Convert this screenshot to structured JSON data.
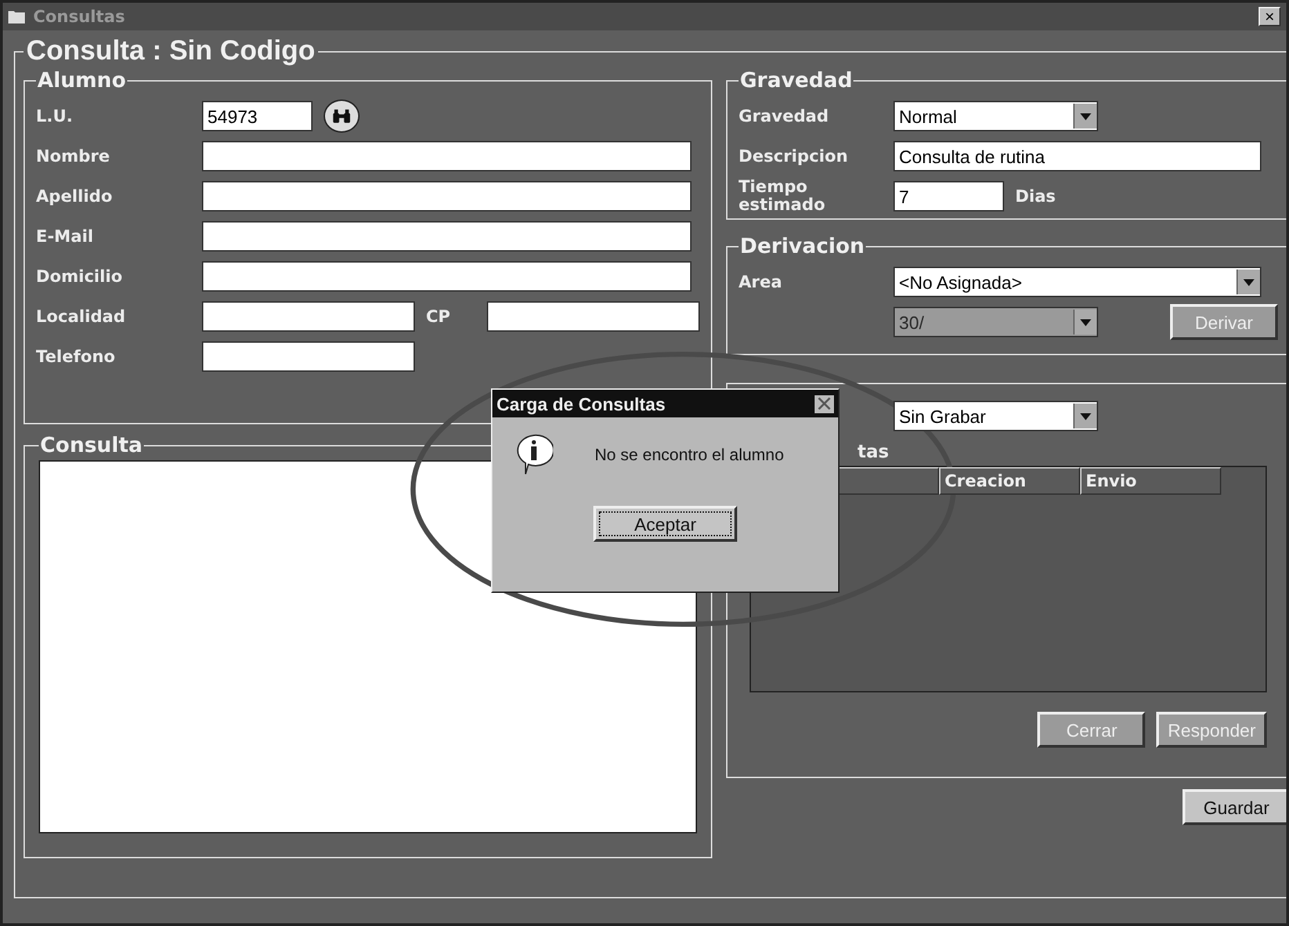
{
  "window": {
    "title": "Consultas",
    "close": "×"
  },
  "form_title": "Consulta : Sin Codigo",
  "alumno": {
    "title": "Alumno",
    "lu": {
      "label": "L.U.",
      "value": "54973"
    },
    "fields": [
      {
        "label": "Nombre"
      },
      {
        "label": "Apellido"
      },
      {
        "label": "E-Mail"
      },
      {
        "label": "Domicilio"
      }
    ],
    "localidad": {
      "label": "Localidad"
    },
    "cp": {
      "label": "CP"
    },
    "telefono": {
      "label": "Telefono"
    }
  },
  "consulta": {
    "title": "Consulta"
  },
  "gravedad": {
    "title": "Gravedad",
    "level_label": "Gravedad",
    "level_value": "Normal",
    "descripcion_label": "Descripcion",
    "descripcion_value": "Consulta de rutina",
    "tiempo_label": "Tiempo estimado",
    "tiempo_value": "7",
    "unit": "Dias"
  },
  "derivacion": {
    "title": "Derivacion",
    "area_label": "Area",
    "area_value": "<No Asignada>",
    "fecha_value": "30/",
    "fecha_disabled": true,
    "button": {
      "label": "Derivar",
      "disabled": true
    }
  },
  "estado": {
    "status_value": "Sin Grabar",
    "respuestas_label": "tas",
    "columns": [
      "Creacion",
      "Envio"
    ],
    "buttons": [
      {
        "label": "Cerrar",
        "disabled": true
      },
      {
        "label": "Responder",
        "disabled": true
      }
    ]
  },
  "save_button": {
    "label": "Guardar",
    "disabled": false
  },
  "dialog": {
    "title": "Carga de Consultas",
    "message": "No se encontro el alumno",
    "button": "Aceptar"
  }
}
